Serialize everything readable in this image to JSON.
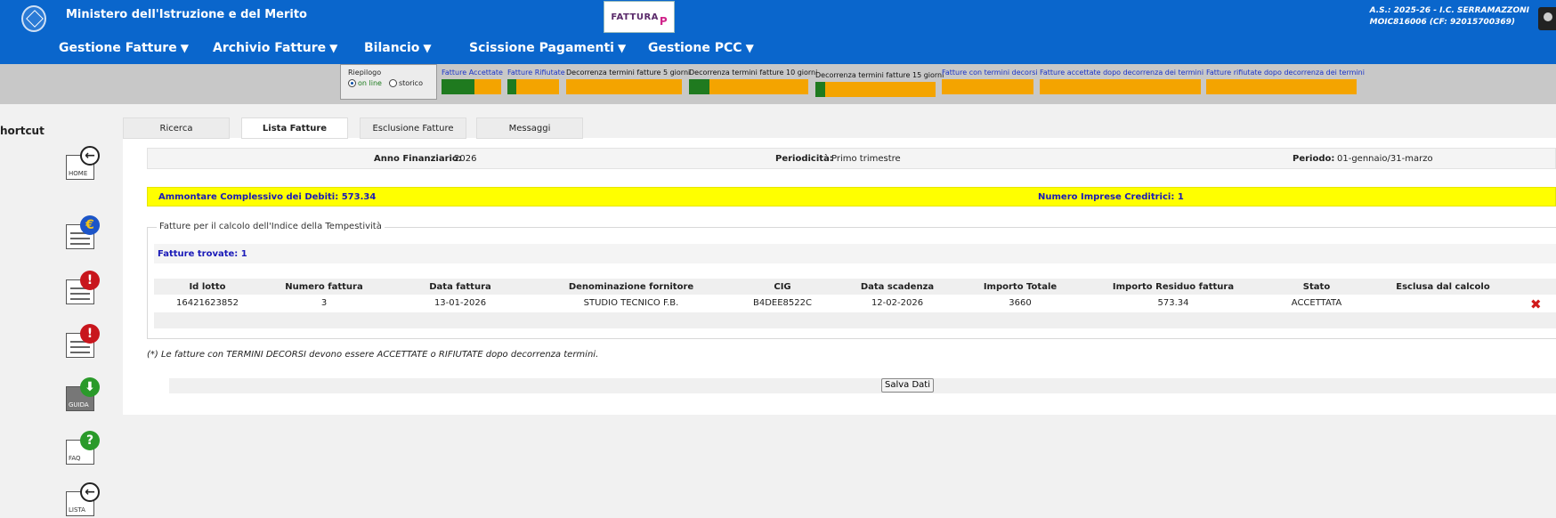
{
  "header": {
    "ministry": "Ministero dell'Istruzione e del Merito",
    "logo_text": "FATTURA",
    "logo_p": "P",
    "school_line1": "A.S.: 2025-26  - I.C. SERRAMAZZONI",
    "school_line2": "MOIC816006  (CF: 92015700369)"
  },
  "nav": {
    "items": [
      {
        "label": "Gestione Fatture",
        "arrow": "▼"
      },
      {
        "label": "Archivio Fatture",
        "arrow": "▼"
      },
      {
        "label": "Bilancio",
        "arrow": "▼"
      },
      {
        "label": "Scissione Pagamenti",
        "arrow": "▼"
      },
      {
        "label": "Gestione PCC",
        "arrow": "▼"
      }
    ]
  },
  "riepilogo": {
    "label": "Riepilogo",
    "option_online": "on line",
    "option_storico": "storico",
    "selected": "on line"
  },
  "indicators": [
    {
      "label": "Fatture Accettate",
      "green_fraction": 0.55
    },
    {
      "label": "Fatture Rifiutate",
      "green_fraction": 0.17
    },
    {
      "label": "Decorrenza termini fatture 5 giorni",
      "green_fraction": 0
    },
    {
      "label": "Decorrenza termini fatture 10 giorni",
      "green_fraction": 0.17
    },
    {
      "label": "Decorrenza termini fatture 15 giorni",
      "green_fraction": 0.08
    },
    {
      "label": "Fatture con termini decorsi",
      "green_fraction": 0
    },
    {
      "label": "Fatture accettate dopo decorrenza dei termini",
      "green_fraction": 0
    },
    {
      "label": "Fatture rifiutate dopo decorrenza dei termini",
      "green_fraction": 0
    }
  ],
  "sidebar": {
    "title": "hortcut",
    "home_caption": "HOME",
    "guida_caption": "GUIDA",
    "faq_caption": "FAQ",
    "lista_caption": "LISTA",
    "euro_symbol": "€",
    "alert_symbol": "!",
    "faq_symbol": "?",
    "download_symbol": "⬇"
  },
  "tabs": [
    {
      "label": "Ricerca"
    },
    {
      "label": "Lista Fatture"
    },
    {
      "label": "Esclusione Fatture"
    },
    {
      "label": "Messaggi"
    }
  ],
  "filters": {
    "anno_label": "Anno Finanziario:",
    "anno_value": "2026",
    "periodicita_label": "Periodicità:",
    "periodicita_value": "Primo trimestre",
    "periodo_label": "Periodo:",
    "periodo_value": "01-gennaio/31-marzo"
  },
  "summary": {
    "debiti": "Ammontare Complessivo dei Debiti: 573.34",
    "imprese": "Numero Imprese Creditrici: 1"
  },
  "section": {
    "legend": "Fatture per il calcolo dell'Indice della Tempestività",
    "found": "Fatture trovate: 1"
  },
  "table": {
    "columns": [
      "Id lotto",
      "Numero fattura",
      "Data fattura",
      "Denominazione fornitore",
      "CIG",
      "Data scadenza",
      "Importo Totale",
      "Importo Residuo fattura",
      "Stato",
      "Esclusa dal calcolo"
    ],
    "rows": [
      [
        "16421623852",
        "3",
        "13-01-2026",
        "STUDIO TECNICO F.B.",
        "B4DEE8522C",
        "12-02-2026",
        "3660",
        "573.34",
        "ACCETTATA"
      ]
    ],
    "delete_symbol": "✖"
  },
  "note": "(*) Le fatture con TERMINI DECORSI devono essere ACCETTATE o RIFIUTATE dopo decorrenza termini.",
  "save_button": "Salva Dati"
}
